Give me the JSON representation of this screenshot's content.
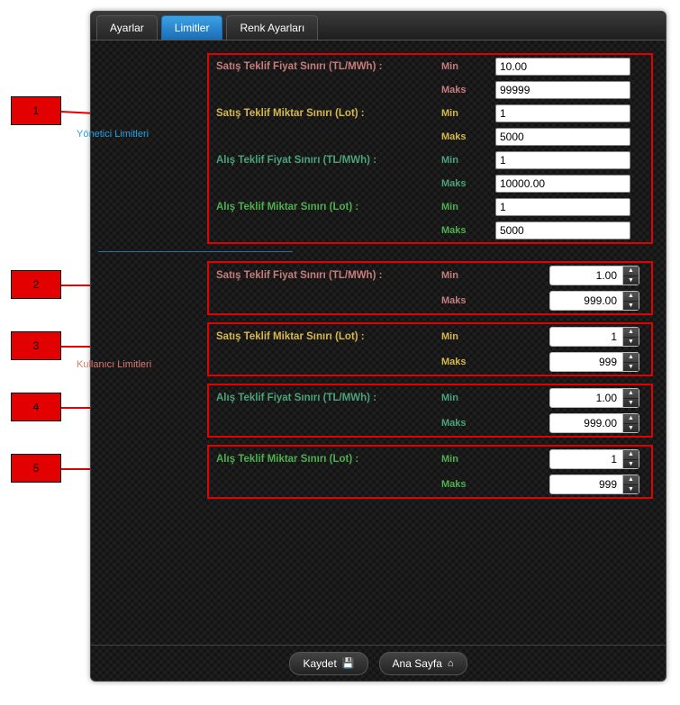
{
  "tabs": {
    "settings": "Ayarlar",
    "limits": "Limitler",
    "colors": "Renk Ayarları"
  },
  "callouts": [
    "1",
    "2",
    "3",
    "4",
    "5"
  ],
  "admin": {
    "section_label": "Yönetici Limitleri",
    "sale_price": {
      "label": "Satış Teklif Fiyat Sınırı (TL/MWh) :",
      "min_label": "Min",
      "maks_label": "Maks",
      "min": "10.00",
      "maks": "99999"
    },
    "sale_qty": {
      "label": "Satış Teklif Miktar Sınırı (Lot) :",
      "min_label": "Min",
      "maks_label": "Maks",
      "min": "1",
      "maks": "5000"
    },
    "buy_price": {
      "label": "Alış Teklif Fiyat Sınırı (TL/MWh) :",
      "min_label": "Min",
      "maks_label": "Maks",
      "min": "1",
      "maks": "10000.00"
    },
    "buy_qty": {
      "label": "Alış Teklif Miktar Sınırı (Lot) :",
      "min_label": "Min",
      "maks_label": "Maks",
      "min": "1",
      "maks": "5000"
    }
  },
  "user": {
    "section_label": "Kullanıcı Limitleri",
    "sale_price": {
      "label": "Satış Teklif Fiyat Sınırı (TL/MWh) :",
      "min_label": "Min",
      "maks_label": "Maks",
      "min": "1.00",
      "maks": "999.00"
    },
    "sale_qty": {
      "label": "Satış Teklif Miktar Sınırı (Lot) :",
      "min_label": "Min",
      "maks_label": "Maks",
      "min": "1",
      "maks": "999"
    },
    "buy_price": {
      "label": "Alış Teklif Fiyat Sınırı (TL/MWh) :",
      "min_label": "Min",
      "maks_label": "Maks",
      "min": "1.00",
      "maks": "999.00"
    },
    "buy_qty": {
      "label": "Alış Teklif Miktar Sınırı (Lot) :",
      "min_label": "Min",
      "maks_label": "Maks",
      "min": "1",
      "maks": "999"
    }
  },
  "footer": {
    "save": "Kaydet",
    "home": "Ana Sayfa"
  }
}
